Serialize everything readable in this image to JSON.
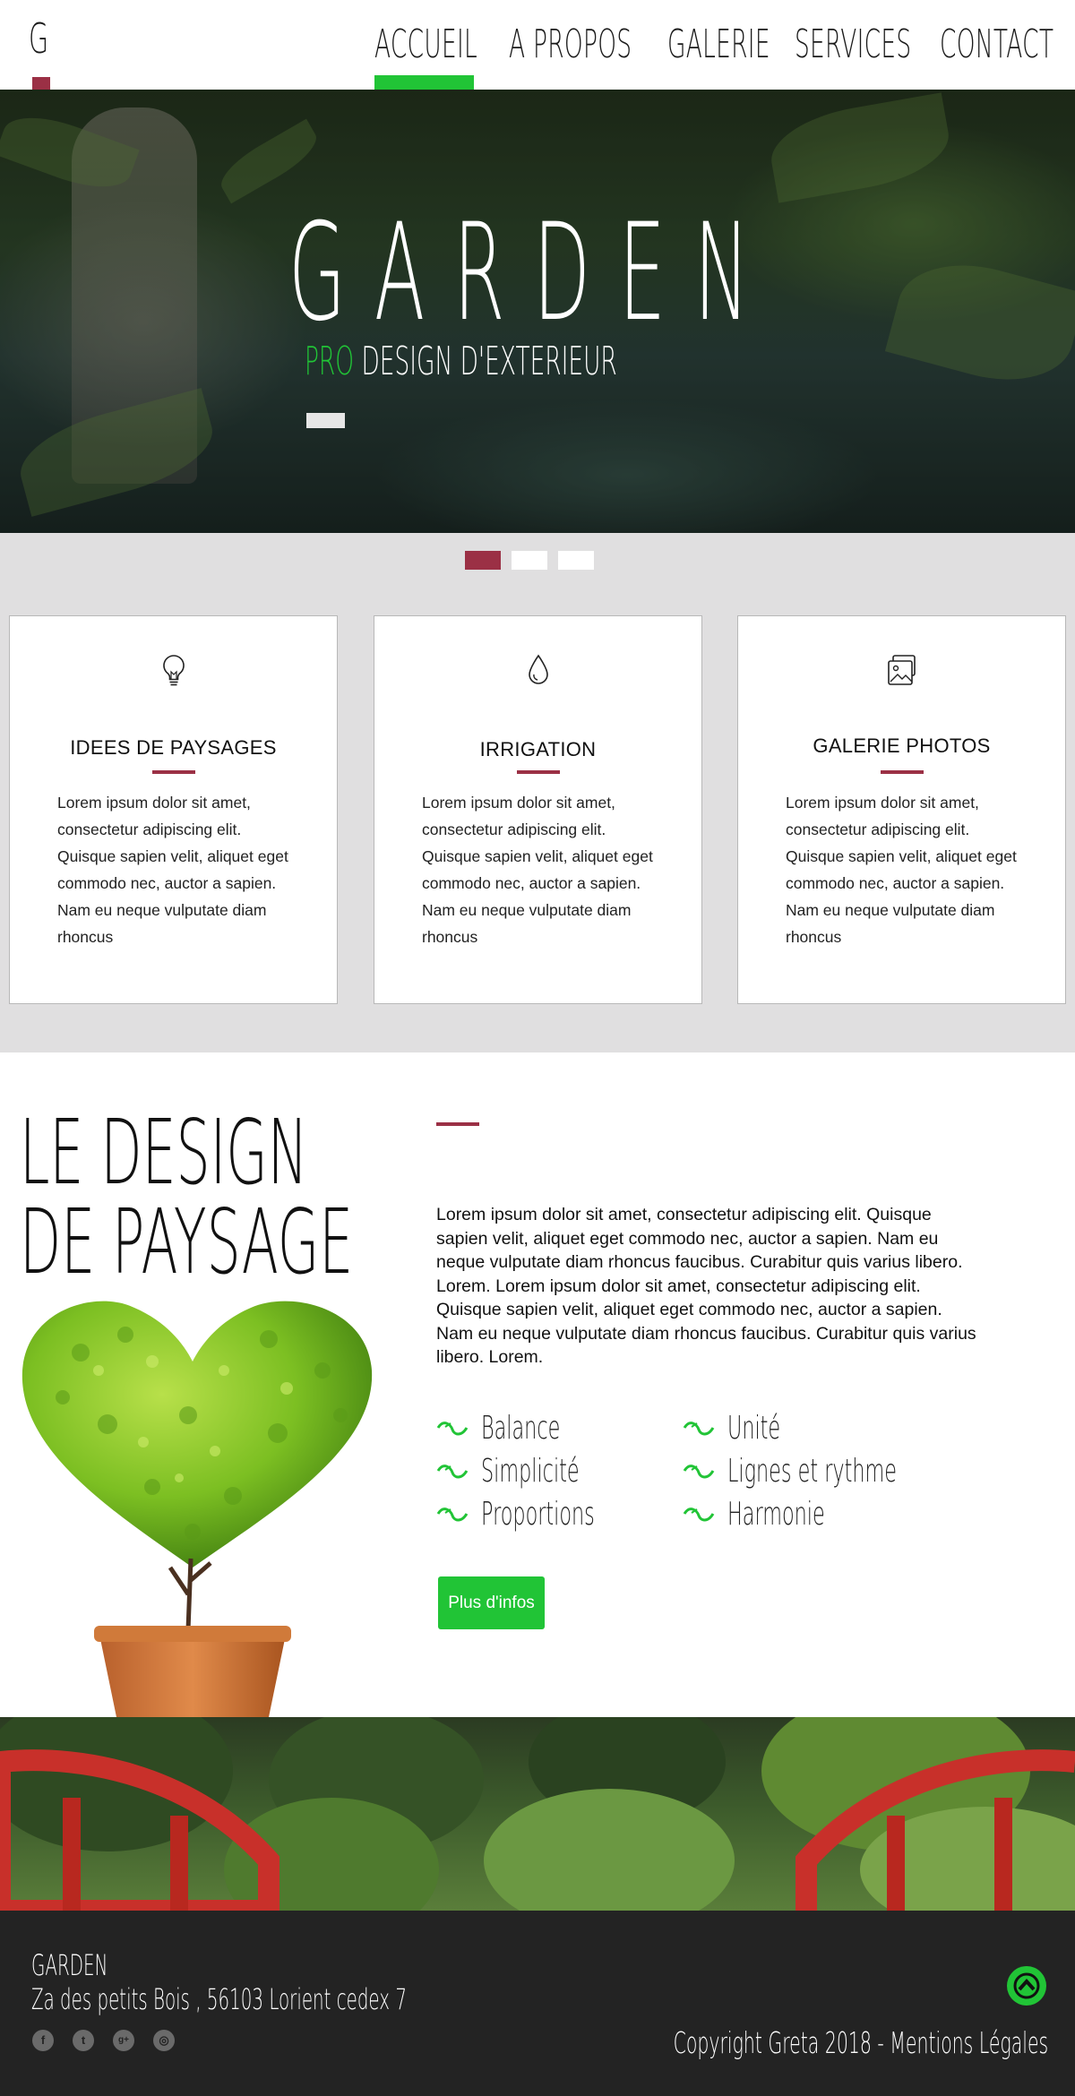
{
  "header": {
    "logo": "G",
    "nav": [
      "ACCUEIL",
      "A PROPOS",
      "GALERIE",
      "SERVICES",
      "CONTACT"
    ],
    "active_nav": "ACCUEIL",
    "accent_color": "#21c436",
    "brand_red": "#9b3045"
  },
  "hero": {
    "title": "GARDEN",
    "subtitle_highlight": "PRO",
    "subtitle_rest": " DESIGN D'EXTERIEUR"
  },
  "slider": {
    "dot_count": 3,
    "active_index": 0
  },
  "services": [
    {
      "icon": "lightbulb-icon",
      "title": "IDEES DE PAYSAGES",
      "text": "Lorem ipsum dolor sit amet, consectetur adipiscing elit. Quisque sapien velit, aliquet eget commodo nec, auctor a sapien. Nam eu neque vulputate diam rhoncus"
    },
    {
      "icon": "water-drop-icon",
      "title": "IRRIGATION",
      "text": "Lorem ipsum dolor sit amet, consectetur adipiscing elit. Quisque sapien velit, aliquet eget commodo nec, auctor a sapien. Nam eu neque vulputate diam rhoncus"
    },
    {
      "icon": "photo-gallery-icon",
      "title": "GALERIE PHOTOS",
      "text": "Lorem ipsum dolor sit amet, consectetur adipiscing elit. Quisque sapien velit, aliquet eget commodo nec, auctor a sapien. Nam eu neque vulputate diam rhoncus"
    }
  ],
  "design": {
    "title_line1": "LE DESIGN",
    "title_line2": "DE PAYSAGE",
    "text": "Lorem ipsum dolor sit amet, consectetur adipiscing elit. Quisque sapien velit, aliquet eget commodo nec, auctor a sapien. Nam eu neque vulputate diam rhoncus faucibus. Curabitur quis varius libero. Lorem. Lorem ipsum dolor sit amet, consectetur adipiscing elit. Quisque sapien velit, aliquet eget commodo nec, auctor a sapien. Nam eu neque vulputate diam rhoncus faucibus. Curabitur quis varius libero. Lorem.",
    "features_left": [
      "Balance",
      "Simplicité",
      "Proportions"
    ],
    "features_right": [
      "Unité",
      "Lignes et rythme",
      "Harmonie"
    ],
    "button": "Plus d'infos"
  },
  "footer": {
    "brand": "GARDEN",
    "address": "Za des petits Bois , 56103 Lorient cedex 7",
    "social_icons": [
      "facebook-icon",
      "twitter-icon",
      "google-plus-icon",
      "instagram-icon"
    ],
    "social_glyphs": [
      "f",
      "t",
      "g+",
      "◎"
    ],
    "copyright": "Copyright Greta 2018 - Mentions Légales"
  }
}
